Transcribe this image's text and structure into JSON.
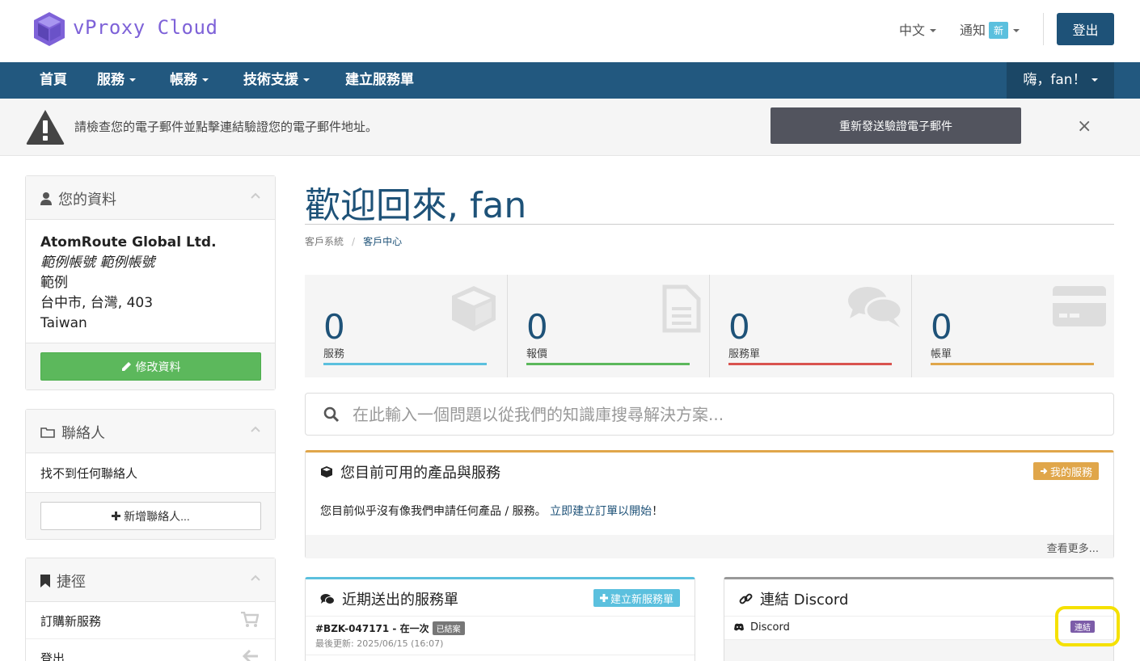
{
  "header": {
    "brand": "vProxy Cloud",
    "language": "中文",
    "notifications": "通知",
    "notifications_badge": "新",
    "logout": "登出"
  },
  "nav": {
    "home": "首頁",
    "services": "服務",
    "billing": "帳務",
    "support": "技術支援",
    "open_ticket": "建立服務單",
    "user_greeting": "嗨，fan！"
  },
  "alert": {
    "message": "請檢查您的電子郵件並點擊連結驗證您的電子郵件地址。",
    "resend_button": "重新發送驗證電子郵件",
    "close": "×"
  },
  "profile": {
    "title": "您的資料",
    "company": "AtomRoute Global Ltd.",
    "name": "範例帳號 範例帳號",
    "address1": "範例",
    "city_line": "台中市, 台灣, 403",
    "country": "Taiwan",
    "edit_button": "修改資料"
  },
  "contacts": {
    "title": "聯絡人",
    "empty": "找不到任何聯絡人",
    "add_button": "新增聯絡人..."
  },
  "shortcuts": {
    "title": "捷徑",
    "items": [
      {
        "label": "訂購新服務",
        "icon": "cart-icon"
      },
      {
        "label": "登出",
        "icon": "arrow-left-icon"
      }
    ]
  },
  "main": {
    "title_cjk": "歡迎回來",
    "title_rest": ", fan",
    "breadcrumb": [
      "客戶系統",
      "客戶中心"
    ],
    "breadcrumb_sep": "/"
  },
  "tiles": [
    {
      "value": "0",
      "label": "服務",
      "color": "#5bc0de",
      "icon": "cube-icon"
    },
    {
      "value": "0",
      "label": "報價",
      "color": "#5cb85c",
      "icon": "document-icon"
    },
    {
      "value": "0",
      "label": "服務單",
      "color": "#d9534f",
      "icon": "comments-icon"
    },
    {
      "value": "0",
      "label": "帳單",
      "color": "#e0a64a",
      "icon": "credit-card-icon"
    }
  ],
  "kb_search": {
    "placeholder": "在此輸入一個問題以從我們的知識庫搜尋解決方案..."
  },
  "products": {
    "title": "您目前可用的產品與服務",
    "button": "我的服務",
    "message": "您目前似乎沒有像我們申請任何產品 / 服務。",
    "link": "立即建立訂單以開始",
    "link_suffix": "！",
    "more": "查看更多..."
  },
  "tickets": {
    "title": "近期送出的服務單",
    "button": "建立新服務單",
    "items": [
      {
        "title": "#BZK-047171 - 在一次",
        "status": "已結案",
        "updated": "最後更新: 2025/06/15 (16:07)"
      }
    ]
  },
  "discord": {
    "title": "連結 Discord",
    "item": "Discord",
    "button": "連結"
  },
  "colors": {
    "primary": "#1e5278",
    "nav": "#22587f",
    "brand": "#7e62d8",
    "success": "#5cb85c",
    "warning": "#e0a64a",
    "info": "#5bc0de",
    "discord": "#7c5ca8",
    "highlight": "#f5e100"
  }
}
